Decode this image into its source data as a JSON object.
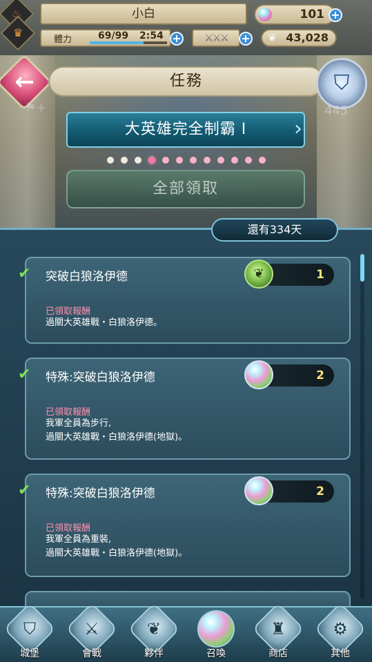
{
  "status": {
    "player_name": "小白",
    "orbs": "101",
    "stamina_label": "體力",
    "stamina_value": "69/99",
    "stamina_timer": "2:54",
    "stamina_fill": 0.7,
    "swords": "⚔⚔⚔",
    "feathers": "43,028"
  },
  "header": {
    "title": "任務",
    "category": "大英雄完全制霸 I",
    "background_count": "445",
    "page_dots": 12,
    "selected_dot": 3
  },
  "claim_all_label": "全部領取",
  "days_left": "還有334天",
  "quests": [
    {
      "title": "突破白狼洛伊德",
      "status": "已領取報酬",
      "description": [
        "過關大英雄戰・白狼洛伊德。"
      ],
      "reward_icon": "hero-badge-icon",
      "reward_count": "1"
    },
    {
      "title": "特殊:突破白狼洛伊德",
      "status": "已領取報酬",
      "description": [
        "我軍全員為步行,",
        "過關大英雄戰・白狼洛伊德(地獄)。"
      ],
      "reward_icon": "orb-icon",
      "reward_count": "2"
    },
    {
      "title": "特殊:突破白狼洛伊德",
      "status": "已領取報酬",
      "description": [
        "我軍全員為重裝,",
        "過關大英雄戰・白狼洛伊德(地獄)。"
      ],
      "reward_icon": "orb-icon",
      "reward_count": "2"
    }
  ],
  "nav": [
    {
      "label": "城堡",
      "icon": "castle-icon"
    },
    {
      "label": "會戰",
      "icon": "crossed-swords-icon"
    },
    {
      "label": "夥伴",
      "icon": "wing-icon"
    },
    {
      "label": "召喚",
      "icon": "orb-icon"
    },
    {
      "label": "商店",
      "icon": "shop-icon"
    },
    {
      "label": "其他",
      "icon": "gear-icon"
    }
  ],
  "colors": {
    "accent_cyan": "#7fd2e8",
    "claimed_pink": "#ff8fae",
    "check_green": "#7ee254",
    "reward_yellow": "#ffe27a"
  }
}
